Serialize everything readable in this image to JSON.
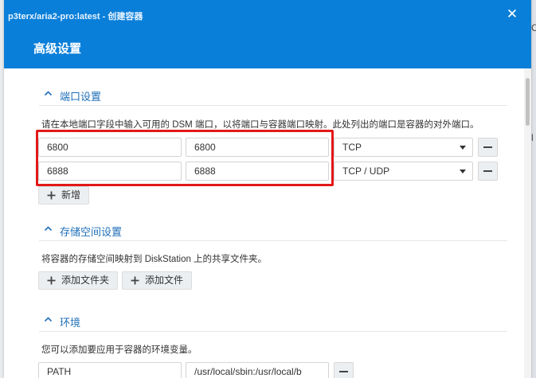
{
  "window": {
    "title": "p3terx/aria2-pro:latest - 创建容器",
    "page_title": "高级设置",
    "close_icon": "close-icon"
  },
  "edge": {
    "chars": [
      "C",
      "l"
    ]
  },
  "ports": {
    "header": "端口设置",
    "description": "请在本地端口字段中输入可用的 DSM 端口，以将端口与容器端口映射。此处列出的端口是容器的对外端口。",
    "rows": [
      {
        "local_port": "6800",
        "container_port": "6800",
        "protocol": "TCP"
      },
      {
        "local_port": "6888",
        "container_port": "6888",
        "protocol": "TCP / UDP"
      }
    ],
    "add_label": "新增"
  },
  "storage": {
    "header": "存储空间设置",
    "description": "将容器的存储空间映射到 DiskStation 上的共享文件夹。",
    "add_folder_label": "添加文件夹",
    "add_file_label": "添加文件"
  },
  "environment": {
    "header": "环境",
    "description": "您可以添加要应用于容器的环境变量。",
    "rows": [
      {
        "name": "PATH",
        "value": "/usr/local/sbin:/usr/local/b"
      }
    ]
  },
  "colors": {
    "titlebar": "#0a7fd9",
    "section_header_text": "#1f6fb8",
    "highlight": "#e31818"
  }
}
